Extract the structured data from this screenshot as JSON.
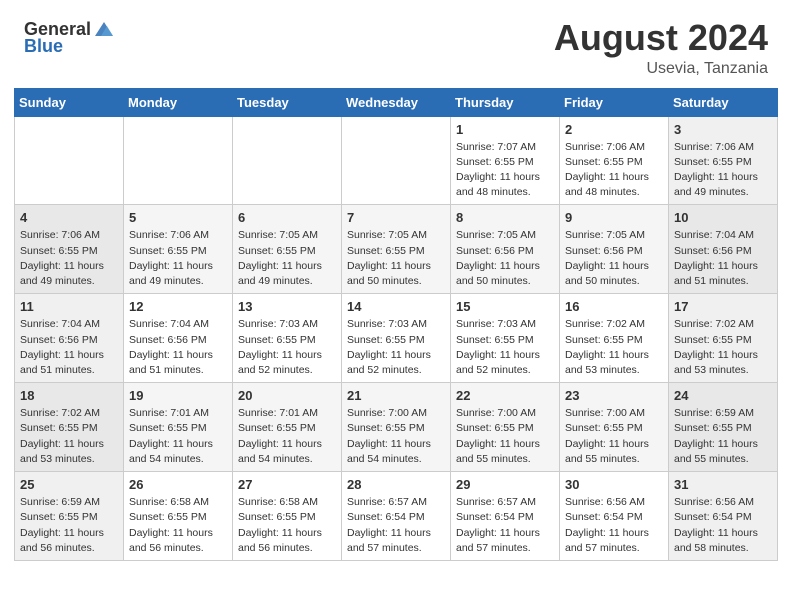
{
  "header": {
    "logo_general": "General",
    "logo_blue": "Blue",
    "title": "August 2024",
    "location": "Usevia, Tanzania"
  },
  "weekdays": [
    "Sunday",
    "Monday",
    "Tuesday",
    "Wednesday",
    "Thursday",
    "Friday",
    "Saturday"
  ],
  "weeks": [
    [
      {
        "day": "",
        "info": ""
      },
      {
        "day": "",
        "info": ""
      },
      {
        "day": "",
        "info": ""
      },
      {
        "day": "",
        "info": ""
      },
      {
        "day": "1",
        "info": "Sunrise: 7:07 AM\nSunset: 6:55 PM\nDaylight: 11 hours\nand 48 minutes."
      },
      {
        "day": "2",
        "info": "Sunrise: 7:06 AM\nSunset: 6:55 PM\nDaylight: 11 hours\nand 48 minutes."
      },
      {
        "day": "3",
        "info": "Sunrise: 7:06 AM\nSunset: 6:55 PM\nDaylight: 11 hours\nand 49 minutes."
      }
    ],
    [
      {
        "day": "4",
        "info": "Sunrise: 7:06 AM\nSunset: 6:55 PM\nDaylight: 11 hours\nand 49 minutes."
      },
      {
        "day": "5",
        "info": "Sunrise: 7:06 AM\nSunset: 6:55 PM\nDaylight: 11 hours\nand 49 minutes."
      },
      {
        "day": "6",
        "info": "Sunrise: 7:05 AM\nSunset: 6:55 PM\nDaylight: 11 hours\nand 49 minutes."
      },
      {
        "day": "7",
        "info": "Sunrise: 7:05 AM\nSunset: 6:55 PM\nDaylight: 11 hours\nand 50 minutes."
      },
      {
        "day": "8",
        "info": "Sunrise: 7:05 AM\nSunset: 6:56 PM\nDaylight: 11 hours\nand 50 minutes."
      },
      {
        "day": "9",
        "info": "Sunrise: 7:05 AM\nSunset: 6:56 PM\nDaylight: 11 hours\nand 50 minutes."
      },
      {
        "day": "10",
        "info": "Sunrise: 7:04 AM\nSunset: 6:56 PM\nDaylight: 11 hours\nand 51 minutes."
      }
    ],
    [
      {
        "day": "11",
        "info": "Sunrise: 7:04 AM\nSunset: 6:56 PM\nDaylight: 11 hours\nand 51 minutes."
      },
      {
        "day": "12",
        "info": "Sunrise: 7:04 AM\nSunset: 6:56 PM\nDaylight: 11 hours\nand 51 minutes."
      },
      {
        "day": "13",
        "info": "Sunrise: 7:03 AM\nSunset: 6:55 PM\nDaylight: 11 hours\nand 52 minutes."
      },
      {
        "day": "14",
        "info": "Sunrise: 7:03 AM\nSunset: 6:55 PM\nDaylight: 11 hours\nand 52 minutes."
      },
      {
        "day": "15",
        "info": "Sunrise: 7:03 AM\nSunset: 6:55 PM\nDaylight: 11 hours\nand 52 minutes."
      },
      {
        "day": "16",
        "info": "Sunrise: 7:02 AM\nSunset: 6:55 PM\nDaylight: 11 hours\nand 53 minutes."
      },
      {
        "day": "17",
        "info": "Sunrise: 7:02 AM\nSunset: 6:55 PM\nDaylight: 11 hours\nand 53 minutes."
      }
    ],
    [
      {
        "day": "18",
        "info": "Sunrise: 7:02 AM\nSunset: 6:55 PM\nDaylight: 11 hours\nand 53 minutes."
      },
      {
        "day": "19",
        "info": "Sunrise: 7:01 AM\nSunset: 6:55 PM\nDaylight: 11 hours\nand 54 minutes."
      },
      {
        "day": "20",
        "info": "Sunrise: 7:01 AM\nSunset: 6:55 PM\nDaylight: 11 hours\nand 54 minutes."
      },
      {
        "day": "21",
        "info": "Sunrise: 7:00 AM\nSunset: 6:55 PM\nDaylight: 11 hours\nand 54 minutes."
      },
      {
        "day": "22",
        "info": "Sunrise: 7:00 AM\nSunset: 6:55 PM\nDaylight: 11 hours\nand 55 minutes."
      },
      {
        "day": "23",
        "info": "Sunrise: 7:00 AM\nSunset: 6:55 PM\nDaylight: 11 hours\nand 55 minutes."
      },
      {
        "day": "24",
        "info": "Sunrise: 6:59 AM\nSunset: 6:55 PM\nDaylight: 11 hours\nand 55 minutes."
      }
    ],
    [
      {
        "day": "25",
        "info": "Sunrise: 6:59 AM\nSunset: 6:55 PM\nDaylight: 11 hours\nand 56 minutes."
      },
      {
        "day": "26",
        "info": "Sunrise: 6:58 AM\nSunset: 6:55 PM\nDaylight: 11 hours\nand 56 minutes."
      },
      {
        "day": "27",
        "info": "Sunrise: 6:58 AM\nSunset: 6:55 PM\nDaylight: 11 hours\nand 56 minutes."
      },
      {
        "day": "28",
        "info": "Sunrise: 6:57 AM\nSunset: 6:54 PM\nDaylight: 11 hours\nand 57 minutes."
      },
      {
        "day": "29",
        "info": "Sunrise: 6:57 AM\nSunset: 6:54 PM\nDaylight: 11 hours\nand 57 minutes."
      },
      {
        "day": "30",
        "info": "Sunrise: 6:56 AM\nSunset: 6:54 PM\nDaylight: 11 hours\nand 57 minutes."
      },
      {
        "day": "31",
        "info": "Sunrise: 6:56 AM\nSunset: 6:54 PM\nDaylight: 11 hours\nand 58 minutes."
      }
    ]
  ]
}
